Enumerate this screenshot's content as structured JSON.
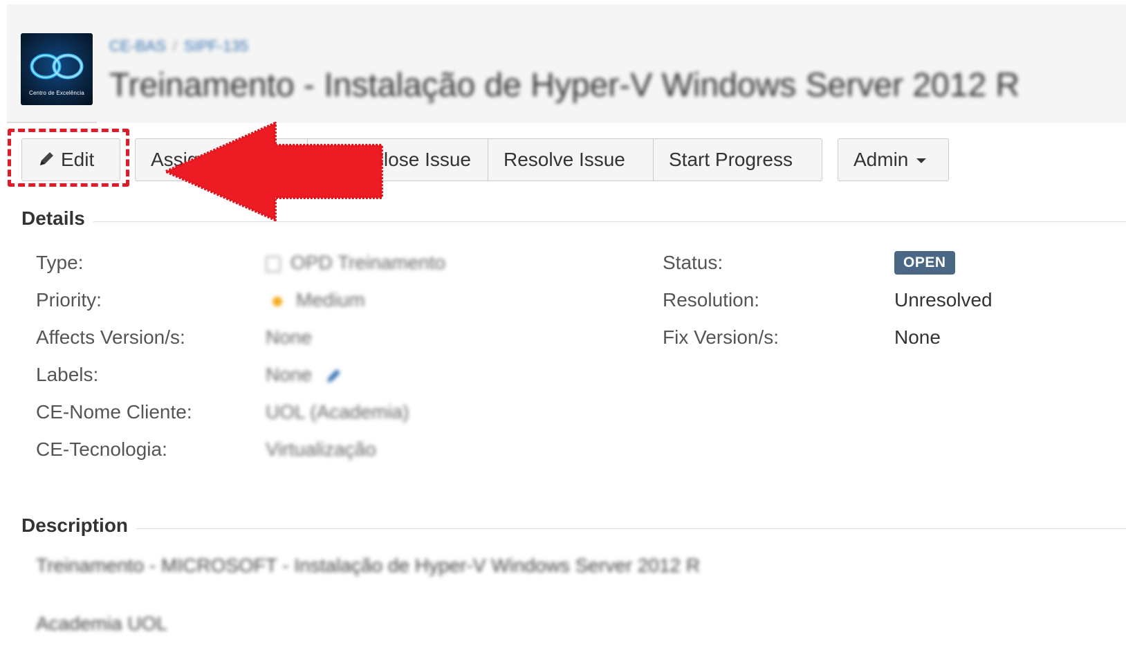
{
  "header": {
    "logo_caption": "Centro de Excelência",
    "breadcrumb": [
      "CE-BAS",
      "SIPF-135"
    ],
    "title": "Treinamento - Instalação de Hyper-V Windows Server 2012 R"
  },
  "toolbar": {
    "edit_label": "Edit",
    "assign_label": "Assign",
    "close_label": "Close Issue",
    "resolve_label": "Resolve Issue",
    "start_progress_label": "Start Progress",
    "admin_label": "Admin"
  },
  "details": {
    "section_title": "Details",
    "left": [
      {
        "label": "Type:",
        "value": "OPD Treinamento"
      },
      {
        "label": "Priority:",
        "value": "Medium"
      },
      {
        "label": "Affects Version/s:",
        "value": "None"
      },
      {
        "label": "Labels:",
        "value": "None"
      },
      {
        "label": "CE-Nome Cliente:",
        "value": "UOL (Academia)"
      },
      {
        "label": "CE-Tecnologia:",
        "value": "Virtualização"
      }
    ],
    "right": [
      {
        "label": "Status:",
        "value": "OPEN"
      },
      {
        "label": "Resolution:",
        "value": "Unresolved"
      },
      {
        "label": "Fix Version/s:",
        "value": "None"
      }
    ]
  },
  "description": {
    "section_title": "Description",
    "lines": [
      "Treinamento - MICROSOFT - Instalação de Hyper-V Windows Server 2012 R",
      "Academia UOL"
    ]
  },
  "colors": {
    "status_badge": "#4a6785",
    "highlight": "#e21b2a",
    "link": "#3572b0"
  },
  "icons": [
    "pencil-icon",
    "caret-down-icon",
    "priority-medium-icon",
    "issue-type-icon",
    "edit-labels-icon"
  ]
}
